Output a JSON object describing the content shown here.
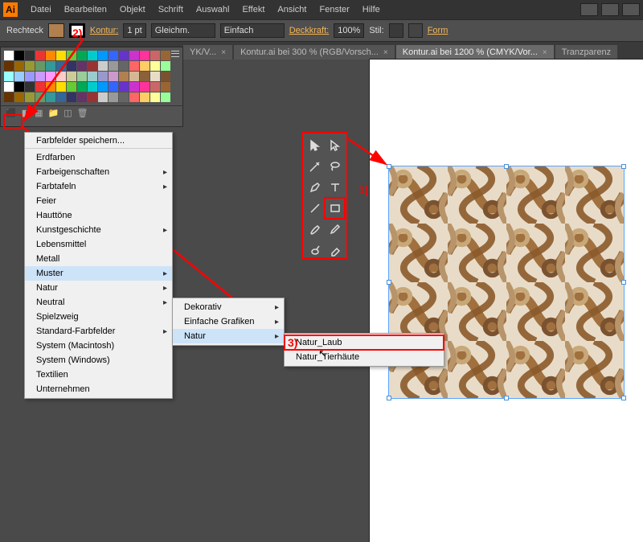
{
  "menubar": {
    "items": [
      "Datei",
      "Bearbeiten",
      "Objekt",
      "Schrift",
      "Auswahl",
      "Effekt",
      "Ansicht",
      "Fenster",
      "Hilfe"
    ]
  },
  "controlbar": {
    "shape": "Rechteck",
    "kontur_label": "Kontur:",
    "kontur_val": "1 pt",
    "dash_label": "Gleichm.",
    "profile_label": "Einfach",
    "opacity_label": "Deckkraft:",
    "opacity_val": "100%",
    "style_label": "Stil:",
    "form_label": "Form"
  },
  "tabs": [
    "YK/V...",
    "Kontur.ai bei 300 % (RGB/Vorsch...",
    "Kontur.ai bei 1200 % (CMYK/Vor...",
    "Tranzparenz"
  ],
  "swatches": {
    "save_label": "Farbfelder speichern...",
    "menu_items": [
      {
        "label": "Erdfarben"
      },
      {
        "label": "Farbeigenschaften",
        "sub": true
      },
      {
        "label": "Farbtafeln",
        "sub": true
      },
      {
        "label": "Feier"
      },
      {
        "label": "Hauttöne"
      },
      {
        "label": "Kunstgeschichte",
        "sub": true
      },
      {
        "label": "Lebensmittel"
      },
      {
        "label": "Metall"
      },
      {
        "label": "Muster",
        "sub": true,
        "hover": true
      },
      {
        "label": "Natur",
        "sub": true
      },
      {
        "label": "Neutral",
        "sub": true
      },
      {
        "label": "Spielzweig"
      },
      {
        "label": "Standard-Farbfelder",
        "sub": true
      },
      {
        "label": "System (Macintosh)"
      },
      {
        "label": "System (Windows)"
      },
      {
        "label": "Textilien"
      },
      {
        "label": "Unternehmen"
      }
    ],
    "submenu2": [
      {
        "label": "Dekorativ",
        "sub": true
      },
      {
        "label": "Einfache Grafiken",
        "sub": true
      },
      {
        "label": "Natur",
        "sub": true,
        "hover": true
      }
    ],
    "submenu3": [
      {
        "label": "Natur_Laub",
        "hl": true
      },
      {
        "label": "Natur_Tierhäute"
      }
    ]
  },
  "annotations": {
    "step1": "1)",
    "step2": "2)",
    "step3": "3)"
  },
  "colors": {
    "accent": "#ff7b00",
    "highlight_red": "#ff0000",
    "panel": "#535353"
  }
}
